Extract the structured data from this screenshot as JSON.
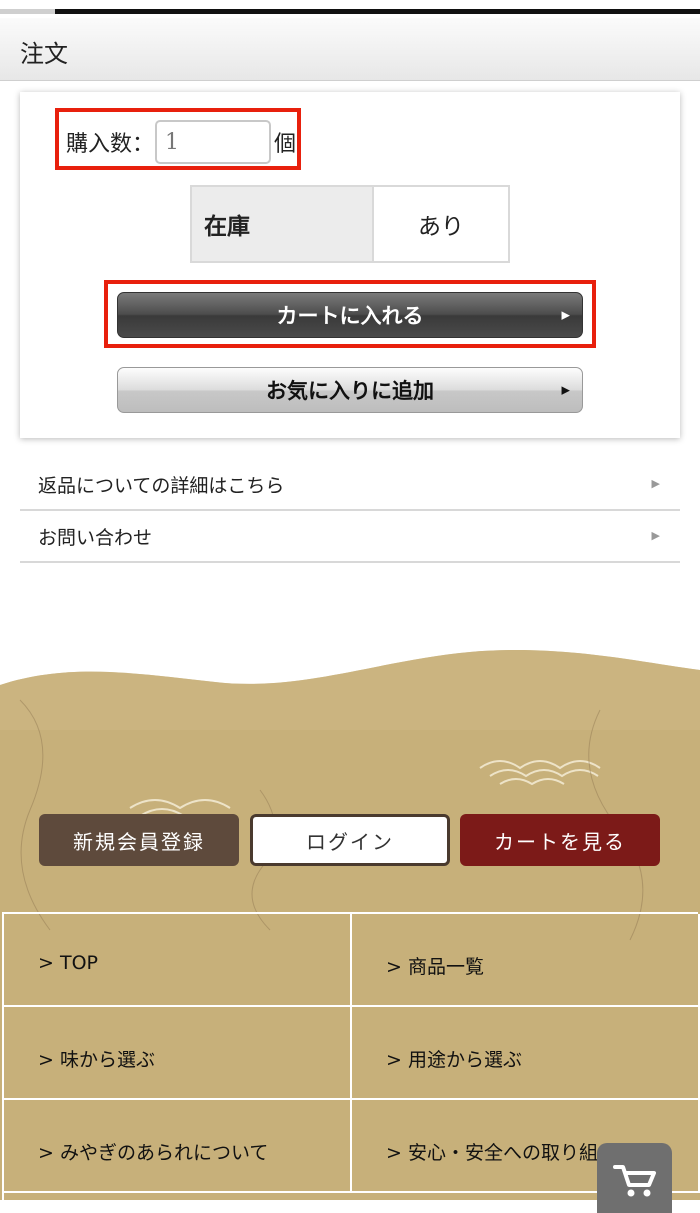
{
  "header": {
    "title": "注文"
  },
  "order": {
    "quantity_label": "購入数：",
    "quantity_value": "1",
    "quantity_unit": "個",
    "stock_label": "在庫",
    "stock_value": "あり",
    "add_to_cart_label": "カートに入れる",
    "add_to_favorites_label": "お気に入りに追加"
  },
  "links": [
    {
      "label": "返品についての詳細はこちら"
    },
    {
      "label": "お問い合わせ"
    }
  ],
  "footer": {
    "register_label": "新規会員登録",
    "login_label": "ログイン",
    "view_cart_label": "カートを見る",
    "nav": [
      {
        "label": "> TOP"
      },
      {
        "label": "> 商品一覧"
      },
      {
        "label": "> 味から選ぶ"
      },
      {
        "label": "> 用途から選ぶ"
      },
      {
        "label": "> みやぎのあられについて"
      },
      {
        "label": "> 安心・安全への取り組み"
      }
    ]
  },
  "colors": {
    "highlight": "#e8200d",
    "register_bg": "#5e4a3c",
    "view_cart_bg": "#7c1a18",
    "footer_paper": "#c7b07a"
  },
  "icons": {
    "row_arrow": "chevron-right-icon",
    "floating_cart": "shopping-cart-icon"
  }
}
